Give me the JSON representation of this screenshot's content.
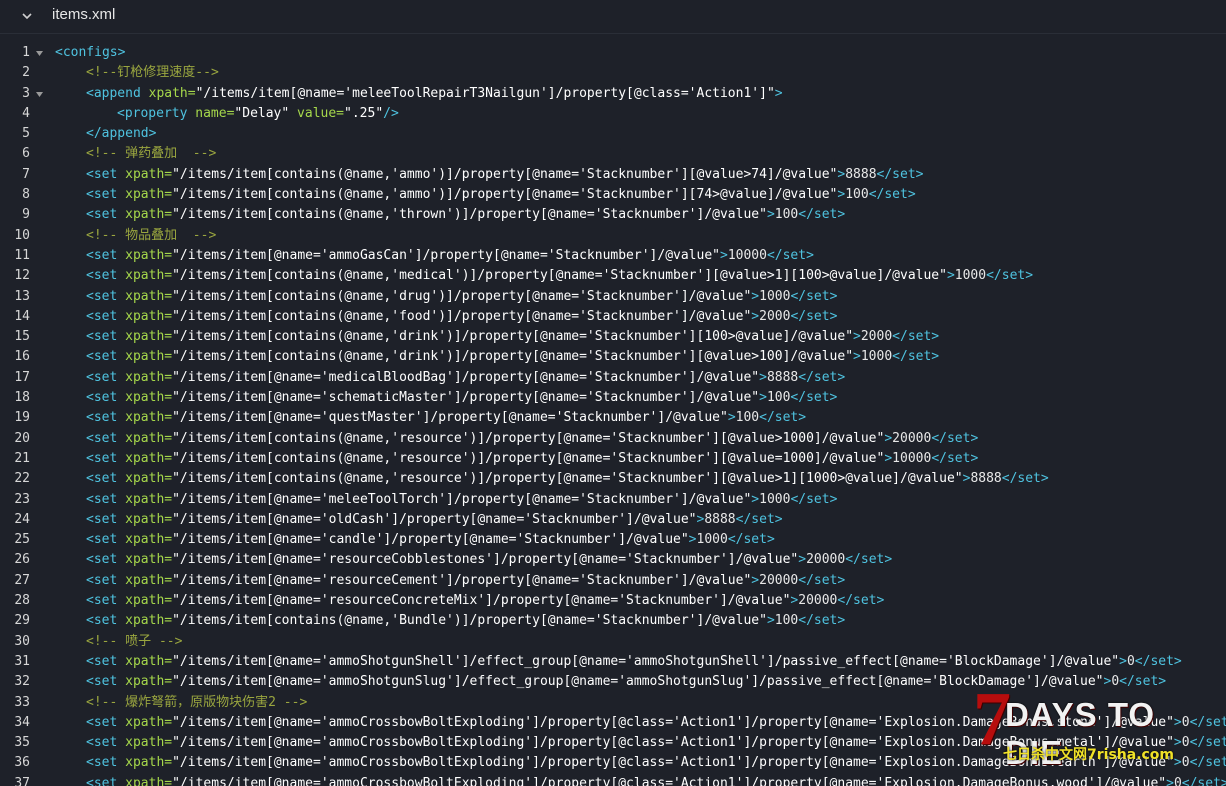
{
  "file": {
    "name": "items.xml",
    "collapse_icon": "chevron-down-icon",
    "fold_icon": "fold-triangle-icon"
  },
  "colors": {
    "background": "#1e2129",
    "tag": "#4fc3e0",
    "attribute": "#a6d84b",
    "string": "#ffffff",
    "comment": "#9aa63f",
    "line_number": "#d7d7d7"
  },
  "lines": [
    {
      "n": "1",
      "indent": 0,
      "fold": true,
      "t": [
        [
          "tag",
          "<configs>"
        ]
      ]
    },
    {
      "n": "2",
      "indent": 1,
      "t": [
        [
          "comment",
          "<!--钉枪修理速度-->"
        ]
      ]
    },
    {
      "n": "3",
      "indent": 1,
      "fold": true,
      "t": [
        [
          "tag",
          "<append "
        ],
        [
          "attr",
          "xpath="
        ],
        [
          "str",
          "\"/items/item[@name='meleeToolRepairT3Nailgun']/property[@class='Action1']\""
        ],
        [
          "tag",
          ">"
        ]
      ]
    },
    {
      "n": "4",
      "indent": 2,
      "t": [
        [
          "tag",
          "<property "
        ],
        [
          "attr",
          "name="
        ],
        [
          "str",
          "\"Delay\" "
        ],
        [
          "attr",
          "value="
        ],
        [
          "str",
          "\".25\""
        ],
        [
          "tag",
          "/>"
        ]
      ]
    },
    {
      "n": "5",
      "indent": 1,
      "t": [
        [
          "tag",
          "</append>"
        ]
      ]
    },
    {
      "n": "6",
      "indent": 1,
      "t": [
        [
          "comment",
          "<!-- 弹药叠加  -->"
        ]
      ]
    },
    {
      "n": "7",
      "indent": 1,
      "t": [
        [
          "tag",
          "<set "
        ],
        [
          "attr",
          "xpath="
        ],
        [
          "str",
          "\"/items/item[contains(@name,'ammo')]/property[@name='Stacknumber'][@value>74]/@value\""
        ],
        [
          "tag",
          ">"
        ],
        [
          "txt",
          "8888"
        ],
        [
          "tag",
          "</set>"
        ]
      ]
    },
    {
      "n": "8",
      "indent": 1,
      "t": [
        [
          "tag",
          "<set "
        ],
        [
          "attr",
          "xpath="
        ],
        [
          "str",
          "\"/items/item[contains(@name,'ammo')]/property[@name='Stacknumber'][74>@value]/@value\""
        ],
        [
          "tag",
          ">"
        ],
        [
          "txt",
          "100"
        ],
        [
          "tag",
          "</set>"
        ]
      ]
    },
    {
      "n": "9",
      "indent": 1,
      "t": [
        [
          "tag",
          "<set "
        ],
        [
          "attr",
          "xpath="
        ],
        [
          "str",
          "\"/items/item[contains(@name,'thrown')]/property[@name='Stacknumber']/@value\""
        ],
        [
          "tag",
          ">"
        ],
        [
          "txt",
          "100"
        ],
        [
          "tag",
          "</set>"
        ]
      ]
    },
    {
      "n": "10",
      "indent": 1,
      "t": [
        [
          "comment",
          "<!-- 物品叠加  -->"
        ]
      ]
    },
    {
      "n": "11",
      "indent": 1,
      "t": [
        [
          "tag",
          "<set "
        ],
        [
          "attr",
          "xpath="
        ],
        [
          "str",
          "\"/items/item[@name='ammoGasCan']/property[@name='Stacknumber']/@value\""
        ],
        [
          "tag",
          ">"
        ],
        [
          "txt",
          "10000"
        ],
        [
          "tag",
          "</set>"
        ]
      ]
    },
    {
      "n": "12",
      "indent": 1,
      "t": [
        [
          "tag",
          "<set "
        ],
        [
          "attr",
          "xpath="
        ],
        [
          "str",
          "\"/items/item[contains(@name,'medical')]/property[@name='Stacknumber'][@value>1][100>@value]/@value\""
        ],
        [
          "tag",
          ">"
        ],
        [
          "txt",
          "1000"
        ],
        [
          "tag",
          "</set>"
        ]
      ]
    },
    {
      "n": "13",
      "indent": 1,
      "t": [
        [
          "tag",
          "<set "
        ],
        [
          "attr",
          "xpath="
        ],
        [
          "str",
          "\"/items/item[contains(@name,'drug')]/property[@name='Stacknumber']/@value\""
        ],
        [
          "tag",
          ">"
        ],
        [
          "txt",
          "1000"
        ],
        [
          "tag",
          "</set>"
        ]
      ]
    },
    {
      "n": "14",
      "indent": 1,
      "t": [
        [
          "tag",
          "<set "
        ],
        [
          "attr",
          "xpath="
        ],
        [
          "str",
          "\"/items/item[contains(@name,'food')]/property[@name='Stacknumber']/@value\""
        ],
        [
          "tag",
          ">"
        ],
        [
          "txt",
          "2000"
        ],
        [
          "tag",
          "</set>"
        ]
      ]
    },
    {
      "n": "15",
      "indent": 1,
      "t": [
        [
          "tag",
          "<set "
        ],
        [
          "attr",
          "xpath="
        ],
        [
          "str",
          "\"/items/item[contains(@name,'drink')]/property[@name='Stacknumber'][100>@value]/@value\""
        ],
        [
          "tag",
          ">"
        ],
        [
          "txt",
          "2000"
        ],
        [
          "tag",
          "</set>"
        ]
      ]
    },
    {
      "n": "16",
      "indent": 1,
      "t": [
        [
          "tag",
          "<set "
        ],
        [
          "attr",
          "xpath="
        ],
        [
          "str",
          "\"/items/item[contains(@name,'drink')]/property[@name='Stacknumber'][@value>100]/@value\""
        ],
        [
          "tag",
          ">"
        ],
        [
          "txt",
          "1000"
        ],
        [
          "tag",
          "</set>"
        ]
      ]
    },
    {
      "n": "17",
      "indent": 1,
      "t": [
        [
          "tag",
          "<set "
        ],
        [
          "attr",
          "xpath="
        ],
        [
          "str",
          "\"/items/item[@name='medicalBloodBag']/property[@name='Stacknumber']/@value\""
        ],
        [
          "tag",
          ">"
        ],
        [
          "txt",
          "8888"
        ],
        [
          "tag",
          "</set>"
        ]
      ]
    },
    {
      "n": "18",
      "indent": 1,
      "t": [
        [
          "tag",
          "<set "
        ],
        [
          "attr",
          "xpath="
        ],
        [
          "str",
          "\"/items/item[@name='schematicMaster']/property[@name='Stacknumber']/@value\""
        ],
        [
          "tag",
          ">"
        ],
        [
          "txt",
          "100"
        ],
        [
          "tag",
          "</set>"
        ]
      ]
    },
    {
      "n": "19",
      "indent": 1,
      "t": [
        [
          "tag",
          "<set "
        ],
        [
          "attr",
          "xpath="
        ],
        [
          "str",
          "\"/items/item[@name='questMaster']/property[@name='Stacknumber']/@value\""
        ],
        [
          "tag",
          ">"
        ],
        [
          "txt",
          "100"
        ],
        [
          "tag",
          "</set>"
        ]
      ]
    },
    {
      "n": "20",
      "indent": 1,
      "t": [
        [
          "tag",
          "<set "
        ],
        [
          "attr",
          "xpath="
        ],
        [
          "str",
          "\"/items/item[contains(@name,'resource')]/property[@name='Stacknumber'][@value>1000]/@value\""
        ],
        [
          "tag",
          ">"
        ],
        [
          "txt",
          "20000"
        ],
        [
          "tag",
          "</set>"
        ]
      ]
    },
    {
      "n": "21",
      "indent": 1,
      "t": [
        [
          "tag",
          "<set "
        ],
        [
          "attr",
          "xpath="
        ],
        [
          "str",
          "\"/items/item[contains(@name,'resource')]/property[@name='Stacknumber'][@value=1000]/@value\""
        ],
        [
          "tag",
          ">"
        ],
        [
          "txt",
          "10000"
        ],
        [
          "tag",
          "</set>"
        ]
      ]
    },
    {
      "n": "22",
      "indent": 1,
      "t": [
        [
          "tag",
          "<set "
        ],
        [
          "attr",
          "xpath="
        ],
        [
          "str",
          "\"/items/item[contains(@name,'resource')]/property[@name='Stacknumber'][@value>1][1000>@value]/@value\""
        ],
        [
          "tag",
          ">"
        ],
        [
          "txt",
          "8888"
        ],
        [
          "tag",
          "</set>"
        ]
      ]
    },
    {
      "n": "23",
      "indent": 1,
      "t": [
        [
          "tag",
          "<set "
        ],
        [
          "attr",
          "xpath="
        ],
        [
          "str",
          "\"/items/item[@name='meleeToolTorch']/property[@name='Stacknumber']/@value\""
        ],
        [
          "tag",
          ">"
        ],
        [
          "txt",
          "1000"
        ],
        [
          "tag",
          "</set>"
        ]
      ]
    },
    {
      "n": "24",
      "indent": 1,
      "t": [
        [
          "tag",
          "<set "
        ],
        [
          "attr",
          "xpath="
        ],
        [
          "str",
          "\"/items/item[@name='oldCash']/property[@name='Stacknumber']/@value\""
        ],
        [
          "tag",
          ">"
        ],
        [
          "txt",
          "8888"
        ],
        [
          "tag",
          "</set>"
        ]
      ]
    },
    {
      "n": "25",
      "indent": 1,
      "t": [
        [
          "tag",
          "<set "
        ],
        [
          "attr",
          "xpath="
        ],
        [
          "str",
          "\"/items/item[@name='candle']/property[@name='Stacknumber']/@value\""
        ],
        [
          "tag",
          ">"
        ],
        [
          "txt",
          "1000"
        ],
        [
          "tag",
          "</set>"
        ]
      ]
    },
    {
      "n": "26",
      "indent": 1,
      "t": [
        [
          "tag",
          "<set "
        ],
        [
          "attr",
          "xpath="
        ],
        [
          "str",
          "\"/items/item[@name='resourceCobblestones']/property[@name='Stacknumber']/@value\""
        ],
        [
          "tag",
          ">"
        ],
        [
          "txt",
          "20000"
        ],
        [
          "tag",
          "</set>"
        ]
      ]
    },
    {
      "n": "27",
      "indent": 1,
      "t": [
        [
          "tag",
          "<set "
        ],
        [
          "attr",
          "xpath="
        ],
        [
          "str",
          "\"/items/item[@name='resourceCement']/property[@name='Stacknumber']/@value\""
        ],
        [
          "tag",
          ">"
        ],
        [
          "txt",
          "20000"
        ],
        [
          "tag",
          "</set>"
        ]
      ]
    },
    {
      "n": "28",
      "indent": 1,
      "t": [
        [
          "tag",
          "<set "
        ],
        [
          "attr",
          "xpath="
        ],
        [
          "str",
          "\"/items/item[@name='resourceConcreteMix']/property[@name='Stacknumber']/@value\""
        ],
        [
          "tag",
          ">"
        ],
        [
          "txt",
          "20000"
        ],
        [
          "tag",
          "</set>"
        ]
      ]
    },
    {
      "n": "29",
      "indent": 1,
      "t": [
        [
          "tag",
          "<set "
        ],
        [
          "attr",
          "xpath="
        ],
        [
          "str",
          "\"/items/item[contains(@name,'Bundle')]/property[@name='Stacknumber']/@value\""
        ],
        [
          "tag",
          ">"
        ],
        [
          "txt",
          "100"
        ],
        [
          "tag",
          "</set>"
        ]
      ]
    },
    {
      "n": "30",
      "indent": 1,
      "t": [
        [
          "comment",
          "<!-- 喷子 -->"
        ]
      ]
    },
    {
      "n": "31",
      "indent": 1,
      "t": [
        [
          "tag",
          "<set "
        ],
        [
          "attr",
          "xpath="
        ],
        [
          "str",
          "\"/items/item[@name='ammoShotgunShell']/effect_group[@name='ammoShotgunShell']/passive_effect[@name='BlockDamage']/@value\""
        ],
        [
          "tag",
          ">"
        ],
        [
          "txt",
          "0"
        ],
        [
          "tag",
          "</set>"
        ]
      ]
    },
    {
      "n": "32",
      "indent": 1,
      "t": [
        [
          "tag",
          "<set "
        ],
        [
          "attr",
          "xpath="
        ],
        [
          "str",
          "\"/items/item[@name='ammoShotgunSlug']/effect_group[@name='ammoShotgunSlug']/passive_effect[@name='BlockDamage']/@value\""
        ],
        [
          "tag",
          ">"
        ],
        [
          "txt",
          "0"
        ],
        [
          "tag",
          "</set>"
        ]
      ]
    },
    {
      "n": "33",
      "indent": 1,
      "t": [
        [
          "comment",
          "<!-- 爆炸弩箭，原版物块伤害2 -->"
        ]
      ]
    },
    {
      "n": "34",
      "indent": 1,
      "t": [
        [
          "tag",
          "<set "
        ],
        [
          "attr",
          "xpath="
        ],
        [
          "str",
          "\"/items/item[@name='ammoCrossbowBoltExploding']/property[@class='Action1']/property[@name='Explosion.DamageBonus.stone']/@value\""
        ],
        [
          "tag",
          ">"
        ],
        [
          "txt",
          "0"
        ],
        [
          "tag",
          "</set>"
        ]
      ]
    },
    {
      "n": "35",
      "indent": 1,
      "t": [
        [
          "tag",
          "<set "
        ],
        [
          "attr",
          "xpath="
        ],
        [
          "str",
          "\"/items/item[@name='ammoCrossbowBoltExploding']/property[@class='Action1']/property[@name='Explosion.DamageBonus.metal']/@value\""
        ],
        [
          "tag",
          ">"
        ],
        [
          "txt",
          "0"
        ],
        [
          "tag",
          "</set>"
        ]
      ]
    },
    {
      "n": "36",
      "indent": 1,
      "t": [
        [
          "tag",
          "<set "
        ],
        [
          "attr",
          "xpath="
        ],
        [
          "str",
          "\"/items/item[@name='ammoCrossbowBoltExploding']/property[@class='Action1']/property[@name='Explosion.DamageBonus.earth']/@value\""
        ],
        [
          "tag",
          ">"
        ],
        [
          "txt",
          "0"
        ],
        [
          "tag",
          "</set>"
        ]
      ]
    },
    {
      "n": "37",
      "indent": 1,
      "t": [
        [
          "tag",
          "<set "
        ],
        [
          "attr",
          "xpath="
        ],
        [
          "str",
          "\"/items/item[@name='ammoCrossbowBoltExploding']/property[@class='Action1']/property[@name='Explosion.DamageBonus.wood']/@value\""
        ],
        [
          "tag",
          ">"
        ],
        [
          "txt",
          "0"
        ],
        [
          "tag",
          "</set>"
        ]
      ]
    }
  ],
  "watermark": {
    "seven": "7",
    "title": "DAYS TO DIE",
    "subtitle": "七日杀中文网7risha.com"
  }
}
